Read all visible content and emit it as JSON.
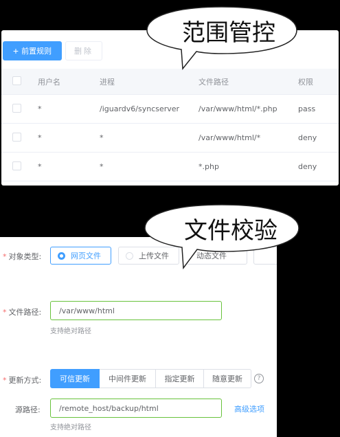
{
  "callouts": {
    "scope_control": "范围管控",
    "file_check": "文件校验"
  },
  "toolbar": {
    "add_icon": "plus-icon",
    "add_label": "前置规则",
    "delete_label": "删除"
  },
  "table": {
    "headers": [
      "用户名",
      "进程",
      "文件路径",
      "权限"
    ],
    "rows": [
      {
        "user": "*",
        "process": "/iguardv6/syncserver",
        "path": "/var/www/html/*.php",
        "perm": "pass"
      },
      {
        "user": "*",
        "process": "*",
        "path": "/var/www/html/*",
        "perm": "deny"
      },
      {
        "user": "*",
        "process": "*",
        "path": "*.php",
        "perm": "deny"
      }
    ]
  },
  "form": {
    "object_type": {
      "label": "对象类型:",
      "options": [
        "网页文件",
        "上传文件",
        "动态文件"
      ],
      "selected": "网页文件"
    },
    "file_path": {
      "label": "文件路径:",
      "value": "/var/www/html",
      "hint": "支持绝对路径"
    },
    "update_mode": {
      "label": "更新方式:",
      "options": [
        "可信更新",
        "中间件更新",
        "指定更新",
        "随意更新"
      ],
      "selected": "可信更新",
      "help_icon": "question-circle-icon"
    },
    "source_path": {
      "label": "源路径:",
      "value": "/remote_host/backup/html",
      "hint": "支持绝对路径",
      "advanced_link": "高级选项"
    }
  },
  "colors": {
    "primary": "#409eff",
    "success_border": "#67c23a",
    "required": "#f56c6c",
    "background": "#000000"
  }
}
